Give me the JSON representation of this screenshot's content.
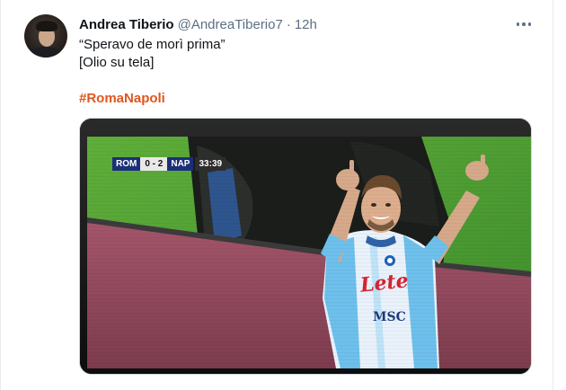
{
  "tweet": {
    "author_name": "Andrea Tiberio",
    "handle": "@AndreaTiberio7",
    "separator": "·",
    "time": "12h",
    "text_line1": "“Speravo de morì prima”",
    "text_line2": "[Olio su tela]",
    "hashtag": "#RomaNapoli",
    "more_icon": "ellipsis-icon",
    "colors": {
      "hashtag": "#e0561f",
      "secondary_text": "#5b7083",
      "primary_text": "#0f1419"
    }
  },
  "media": {
    "scorebug": {
      "home": "ROM",
      "score": "0 - 2",
      "away": "NAP",
      "clock": "33:39"
    },
    "jersey_sponsor": "Lete",
    "jersey_sponsor2": "MSC"
  }
}
